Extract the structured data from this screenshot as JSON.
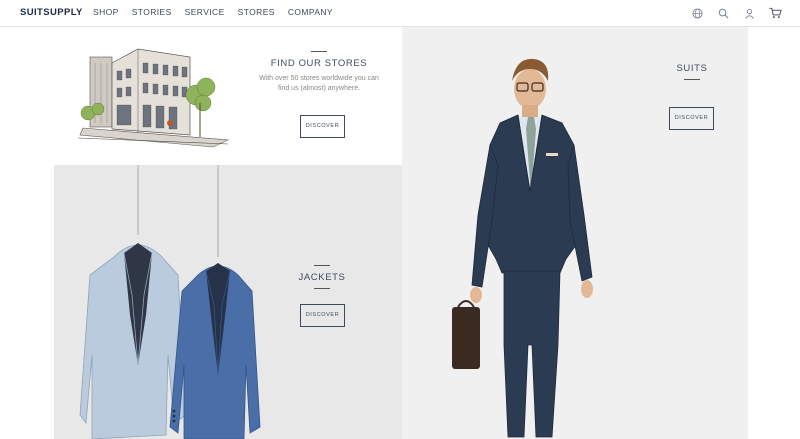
{
  "header": {
    "logo": "SUITSUPPLY",
    "nav": [
      "SHOP",
      "STORIES",
      "SERVICE",
      "STORES",
      "COMPANY"
    ],
    "icons": [
      "globe-icon",
      "search-icon",
      "user-icon",
      "cart-icon"
    ]
  },
  "stores": {
    "title": "FIND OUR STORES",
    "subtitle_line1": "With over 50 stores worldwide you can",
    "subtitle_line2": "find us (almost) anywhere.",
    "button": "DISCOVER"
  },
  "jackets": {
    "title": "JACKETS",
    "button": "DISCOVER"
  },
  "suits": {
    "title": "SUITS",
    "button": "DISCOVER"
  },
  "colors": {
    "navy": "#1c2b44",
    "suit": "#2b3b52",
    "panel_grey": "#e8e8e8",
    "jacket_light": "#b9cbdc",
    "jacket_blue": "#4a6fa8"
  }
}
